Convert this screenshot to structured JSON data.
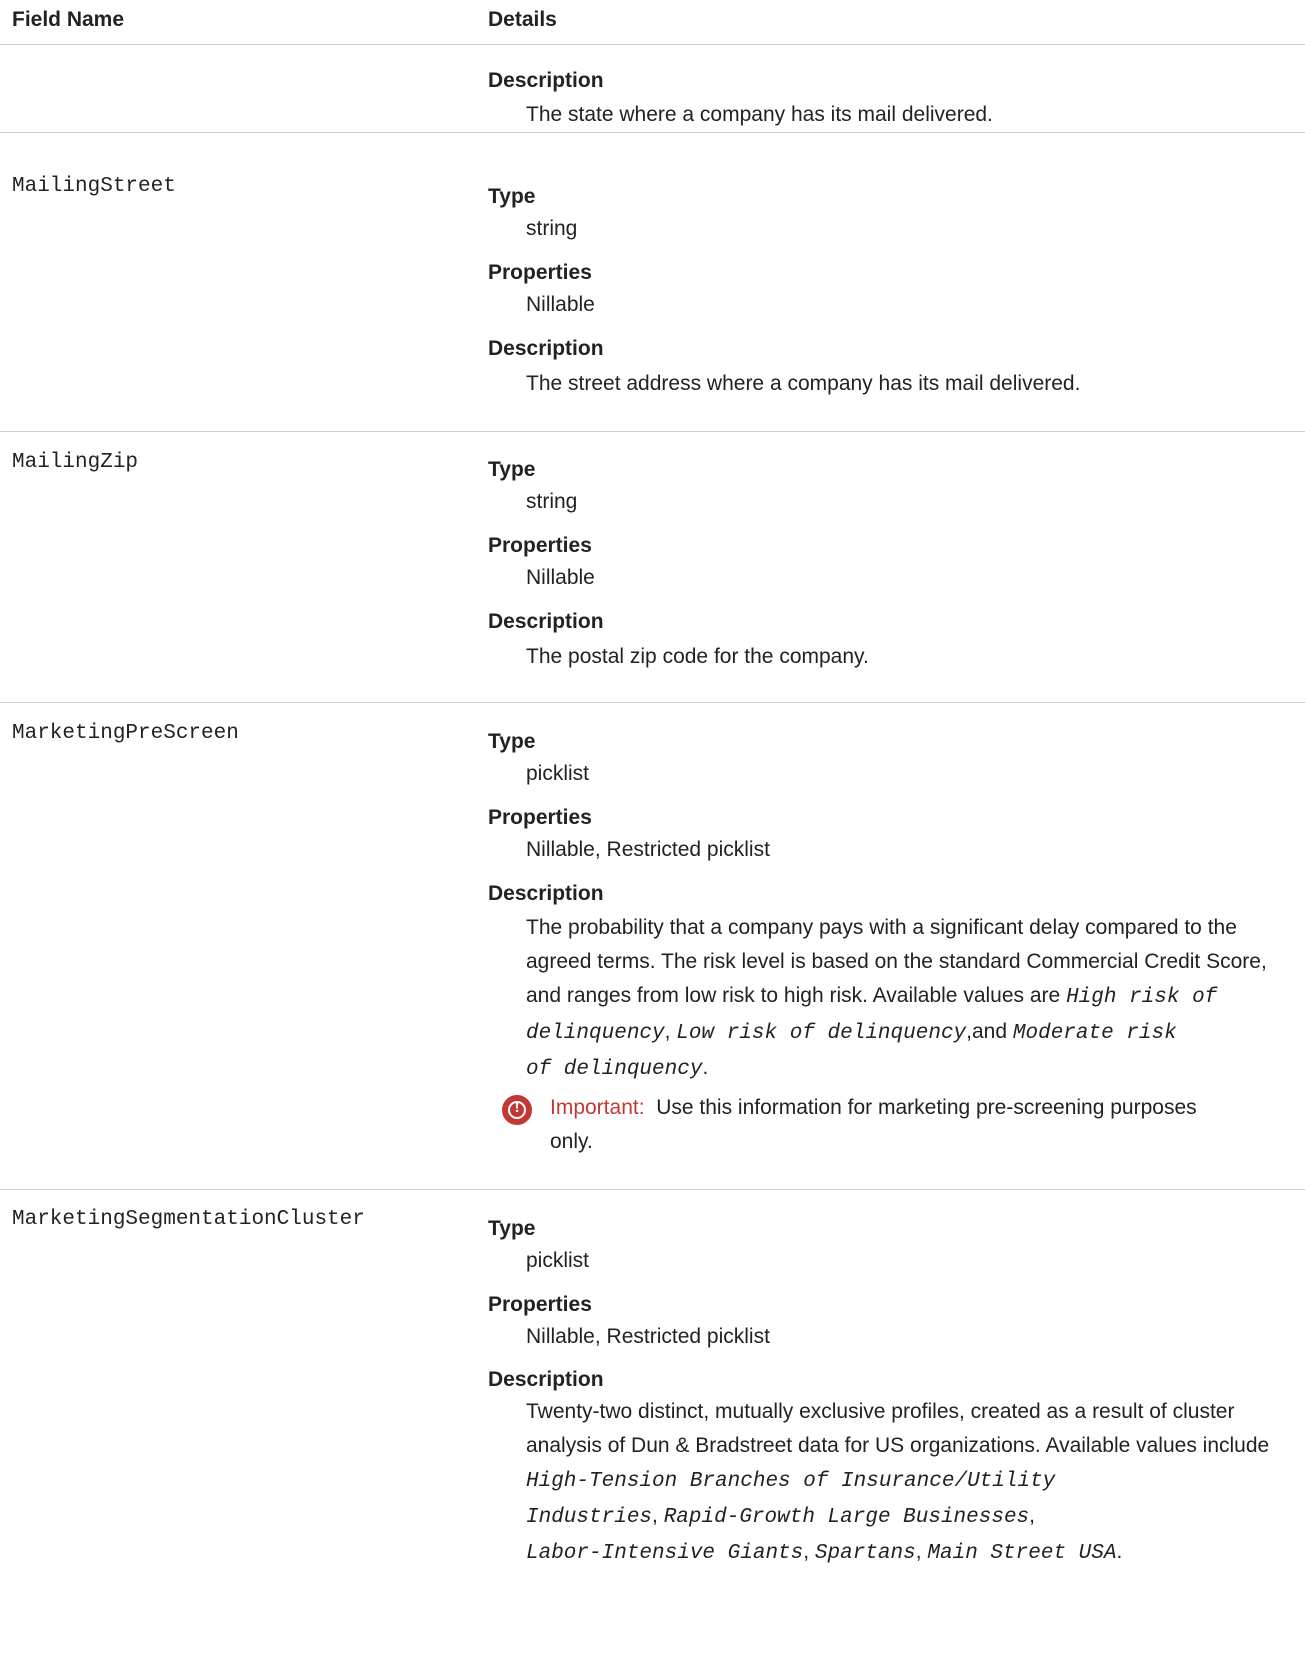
{
  "header": {
    "field_name": "Field Name",
    "details": "Details"
  },
  "labels": {
    "type": "Type",
    "properties": "Properties",
    "description": "Description",
    "important": "Important:"
  },
  "row0": {
    "description": "The state where a company has its mail delivered."
  },
  "row1": {
    "name": "MailingStreet",
    "type": "string",
    "properties": "Nillable",
    "description": "The street address where a company has its mail delivered."
  },
  "row2": {
    "name": "MailingZip",
    "type": "string",
    "properties": "Nillable",
    "description": "The postal zip code for the company."
  },
  "row3": {
    "name": "MarketingPreScreen",
    "type": "picklist",
    "properties": "Nillable, Restricted picklist",
    "description_lines": [
      "The probability that a company pays with a significant delay compared to the",
      "agreed terms. The risk level is based on the standard Commercial Credit Score,",
      "and ranges from low risk to high risk. Available values are"
    ],
    "values": [
      "High risk of delinquency",
      "Low risk of delinquency",
      "Moderate risk of delinquency"
    ],
    "value_parts": {
      "v1a": "High risk of",
      "v1b": "delinquency",
      "v2": "Low risk of delinquency",
      "v3a": "Moderate risk",
      "v3b": "of delinquency"
    },
    "and_word": "and",
    "important_icon": "exclamation-circle-icon",
    "important_text": "Use this information for marketing pre-screening purposes",
    "important_text_2": "only."
  },
  "row4": {
    "name": "MarketingSegmentationCluster",
    "type": "picklist",
    "properties": "Nillable, Restricted picklist",
    "description_lines": [
      "Twenty-two distinct, mutually exclusive profiles, created as a result of cluster",
      "analysis of Dun & Bradstreet data for US organizations. Available values include"
    ],
    "values": [
      "High-Tension Branches of Insurance/Utility Industries",
      "Rapid-Growth Large Businesses",
      "Labor-Intensive Giants",
      "Spartans",
      "Main Street USA"
    ],
    "value_parts": {
      "v1a": "High-Tension Branches of Insurance/Utility",
      "v1b": "Industries",
      "v2": "Rapid-Growth Large Businesses",
      "v3": "Labor-Intensive Giants",
      "v4": "Spartans",
      "v5": "Main Street USA"
    }
  },
  "colors": {
    "accent_red": "#c23934",
    "divider": "#cfcfcf",
    "text": "#222222"
  }
}
